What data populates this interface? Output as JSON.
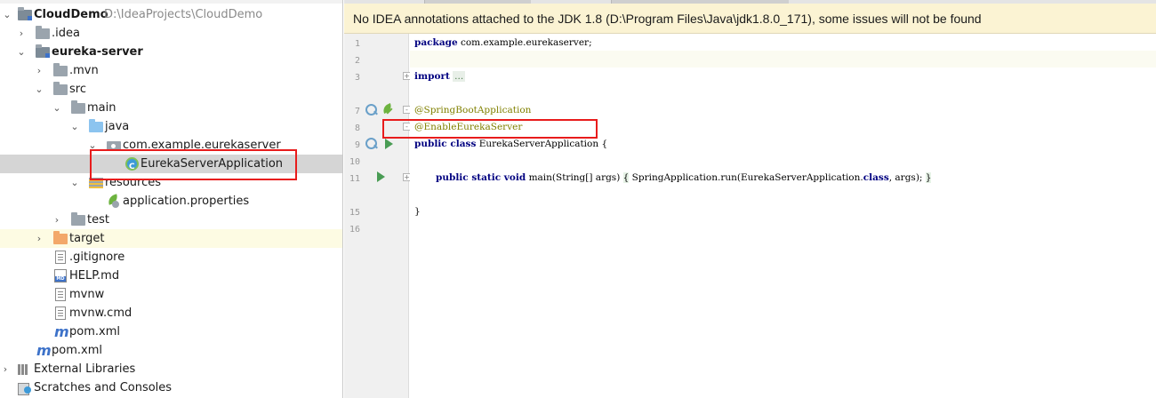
{
  "project_tree": {
    "rows": [
      {
        "label": "CloudDemo",
        "path": "D:\\IdeaProjects\\CloudDemo"
      },
      {
        "label": ".idea"
      },
      {
        "label": "eureka-server"
      },
      {
        "label": ".mvn"
      },
      {
        "label": "src"
      },
      {
        "label": "main"
      },
      {
        "label": "java"
      },
      {
        "label": "com.example.eurekaserver"
      },
      {
        "label": "EurekaServerApplication"
      },
      {
        "label": "resources"
      },
      {
        "label": "application.properties"
      },
      {
        "label": "test"
      },
      {
        "label": "target"
      },
      {
        "label": ".gitignore"
      },
      {
        "label": "HELP.md"
      },
      {
        "label": "mvnw"
      },
      {
        "label": "mvnw.cmd"
      },
      {
        "label": "pom.xml"
      },
      {
        "label": "pom.xml"
      },
      {
        "label": "External Libraries"
      },
      {
        "label": "Scratches and Consoles"
      }
    ],
    "selected_item": "EurekaServerApplication",
    "highlighted_item": "target"
  },
  "editor": {
    "banner": "No IDEA annotations attached to the JDK 1.8 (D:\\Program Files\\Java\\jdk1.8.0_171), some issues will not be found",
    "line_numbers": [
      "1",
      "2",
      "3",
      "7",
      "8",
      "9",
      "10",
      "11",
      "15",
      "16"
    ],
    "code": {
      "l1_kw": "package",
      "l1_rest": " com.example.eurekaserver;",
      "l3_kw": "import",
      "l3_dots": "...",
      "l7": "@SpringBootApplication",
      "l8": "@EnableEurekaServer",
      "l9_kw": "public class",
      "l9_rest": " EurekaServerApplication {",
      "l11_kw": "public static void",
      "l11_a": " main(String[] args) ",
      "l11_b": "{",
      "l11_c": " SpringApplication.run(EurekaServerApplication.",
      "l11_d": "class",
      "l11_e": ", args); ",
      "l11_f": "}",
      "l15": "}"
    }
  },
  "colors": {
    "highlight_box": "#e81c1c",
    "banner_bg": "#fbf3d3",
    "selected_row": "#d5d5d5",
    "keyword": "#000080",
    "annotation": "#808000"
  }
}
